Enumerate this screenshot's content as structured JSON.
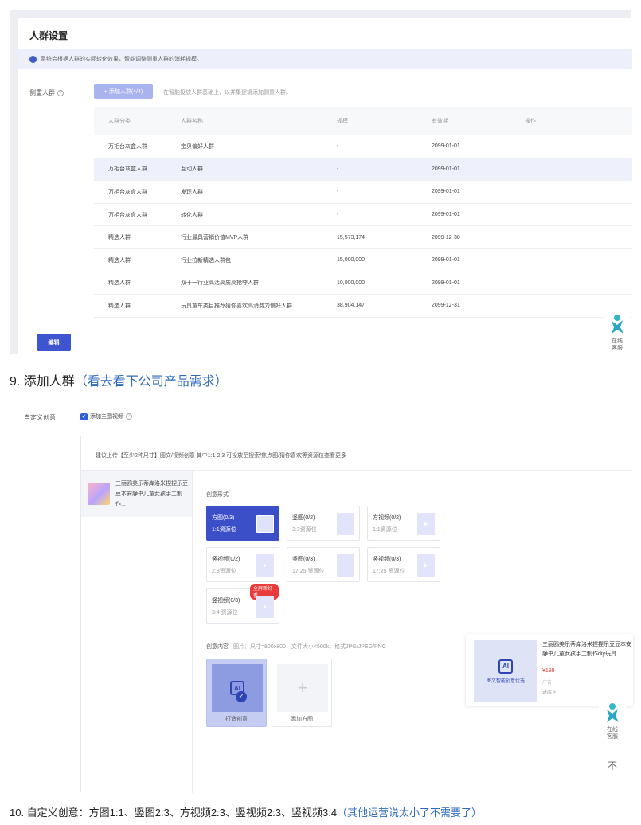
{
  "audience": {
    "title": "人群设置",
    "info_icon": "i",
    "info_text": "系统会根据人群的实际转化效果，智能调整侧重人群的消耗规模。",
    "field_label": "侧重人群",
    "help_icon": "?",
    "add_button": "+ 添加人群(4/4)",
    "add_hint": "在智能投放人群基础上，以并集逻辑添加侧重人群。",
    "columns": [
      "人群分类",
      "人群名称",
      "规模",
      "有效期",
      "操作"
    ],
    "rows": [
      [
        "万相台灰盒人群",
        "宝贝偏好人群",
        "-",
        "2099-01-01",
        ""
      ],
      [
        "万相台灰盒人群",
        "互动人群",
        "-",
        "2099-01-01",
        ""
      ],
      [
        "万相台灰盒人群",
        "发现人群",
        "-",
        "2099-01-01",
        ""
      ],
      [
        "万相台灰盒人群",
        "转化人群",
        "-",
        "2099-01-01",
        ""
      ],
      [
        "精选人群",
        "行业最具营销价值MVP人群",
        "15,573,174",
        "2099-12-30",
        ""
      ],
      [
        "精选人群",
        "行业拉新精选人群包",
        "15,000,000",
        "2099-01-01",
        ""
      ],
      [
        "精选人群",
        "双十一行业高活高质高抢夺人群",
        "10,000,000",
        "2099-01-01",
        ""
      ],
      [
        "精选人群",
        "玩具童车类目推荐猜你喜欢高消费力偏好人群",
        "38,904,147",
        "2099-12-31",
        ""
      ]
    ],
    "edit_button": "编辑",
    "service_label_1": "在线",
    "service_label_2": "客服"
  },
  "heading9": {
    "main": "9.  添加人群",
    "note": "（看去看下公司产品需求）"
  },
  "creative": {
    "label": "自定义创意",
    "checkbox_label": "添加主图视频",
    "checkbox_icon": "✓",
    "help_icon": "?",
    "upload_hint": "建议上传【至少2种尺寸】图文/视频创意 其中1:1 2:3 可投放至搜索/焦点图/猜你喜欢等资源位查看更多",
    "product_title": "三丽鸥美乐蒂库洛米捏捏乐豆豆本安静书儿童女孩手工制作...",
    "form_label": "创意形式",
    "formats": [
      {
        "name": "方图(0/3)",
        "slot": "1:1资源位"
      },
      {
        "name": "竖图(0/2)",
        "slot": "2:3资源位"
      },
      {
        "name": "方视频(0/2)",
        "slot": "1:1资源位"
      },
      {
        "name": "竖视频(0/2)",
        "slot": "2:3资源位"
      },
      {
        "name": "竖图(0/3)",
        "slot": "17:25 资源位"
      },
      {
        "name": "竖视频(0/3)",
        "slot": "17:25 资源位"
      },
      {
        "name": "竖视频(0/3)",
        "slot": "3:4 资源位"
      }
    ],
    "fullscreen_badge": "全屏新好看",
    "content_label": "创意内容",
    "content_spec": "图片：尺寸=800x800，文件大小<500k，格式JPG/JPEG/PNG",
    "ai_icon_text": "AI",
    "tiles": [
      {
        "label": "打造创意"
      },
      {
        "label": "添加方图"
      }
    ],
    "preview": {
      "ai_text": "AI",
      "img_caption": "图文智能创意优选",
      "title": "三丽鸥美乐蒂库洛米捏捏乐豆豆本安静书儿童女孩手工制作diy玩具",
      "price": "¥199",
      "ad_tag": "广告",
      "shop": "进店 >"
    },
    "service_label_1": "在线",
    "service_label_2": "客服",
    "back_top_icon": "不"
  },
  "heading10": {
    "main": "10. 自定义创意：方图1:1、竖图2:3、方视频2:3、竖视频2:3、竖视频3:4",
    "note": "（其他运营说太小了不需要了）"
  },
  "colors": {
    "primary": "#3d55cf",
    "info_bg": "#edf0fb",
    "highlight_row": "#eef1fb",
    "note_blue": "#2f6bbd"
  }
}
